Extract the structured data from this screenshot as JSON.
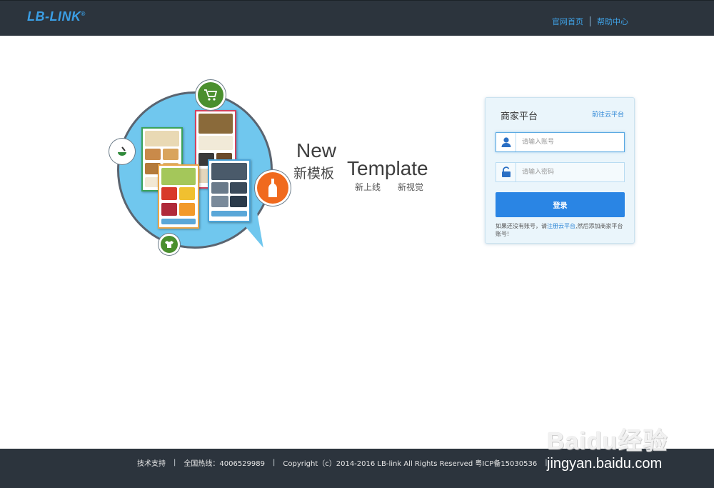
{
  "header": {
    "logo_text": "LB-LINK",
    "logo_mark": "®",
    "nav": [
      {
        "label": "官网首页"
      },
      {
        "label": "帮助中心"
      }
    ]
  },
  "hero": {
    "new_en": "New",
    "new_cn": "新模板",
    "template_en": "Template",
    "line1_cn": "新上线",
    "line2_cn": "新视觉",
    "icons": [
      "shopping-cart-icon",
      "tea-icon",
      "bottle-icon",
      "tshirt-icon"
    ]
  },
  "login": {
    "title": "商家平台",
    "goto_link": "前往云平台",
    "username_placeholder": "请输入账号",
    "password_placeholder": "请输入密码",
    "submit_label": "登录",
    "tip_before": "如果还没有账号，请",
    "tip_link": "注册云平台",
    "tip_after": ",然后添加商家平台账号!"
  },
  "footer": {
    "support": "技术支持",
    "hotline": "全国热线：4006529989",
    "copyright": "Copyright（c）2014-2016 LB-link All Rights Reserved 粤ICP备15030536",
    "sep": "|"
  },
  "watermark": {
    "brand": "Baidu经验",
    "url": "jingyan.baidu.com"
  },
  "colors": {
    "header_bg": "#2c343d",
    "accent": "#2a85e4",
    "link": "#3fa2e6",
    "bubble": "#70c7ee"
  }
}
